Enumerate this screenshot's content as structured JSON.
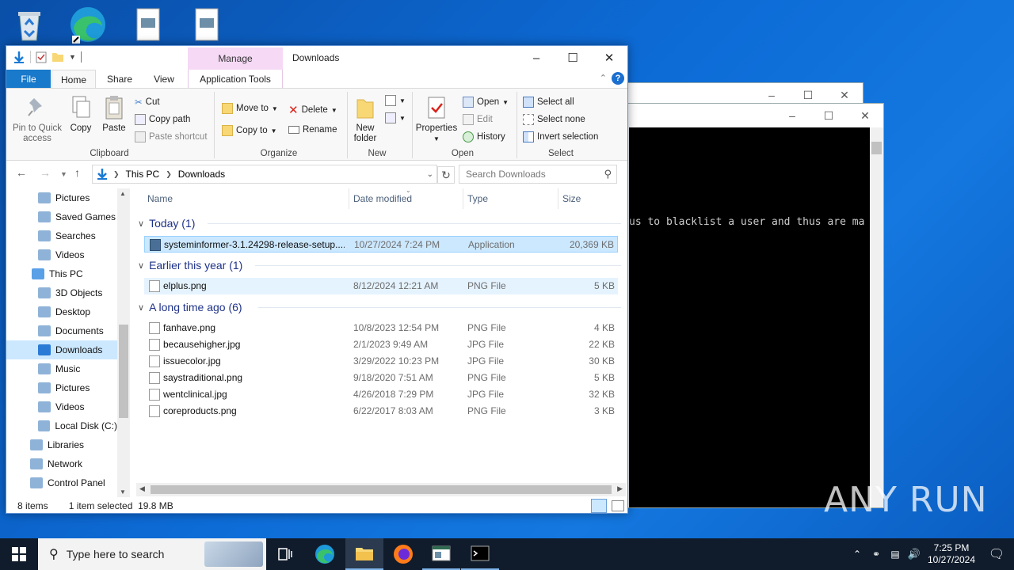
{
  "desktop": {
    "icons": [
      "recycle-bin",
      "edge",
      "image-file",
      "image-file"
    ]
  },
  "console_window": {
    "text": "us to blacklist a user and thus are ma"
  },
  "explorer": {
    "manage_tab": "Manage",
    "title": "Downloads",
    "tabs": {
      "file": "File",
      "home": "Home",
      "share": "Share",
      "view": "View",
      "app_tools": "Application Tools"
    },
    "ribbon": {
      "clipboard": {
        "pin": "Pin to Quick access",
        "copy": "Copy",
        "paste": "Paste",
        "cut": "Cut",
        "copy_path": "Copy path",
        "paste_shortcut": "Paste shortcut",
        "label": "Clipboard"
      },
      "organize": {
        "move_to": "Move to",
        "copy_to": "Copy to",
        "delete": "Delete",
        "rename": "Rename",
        "label": "Organize"
      },
      "new": {
        "new_folder": "New folder",
        "label": "New"
      },
      "open": {
        "properties": "Properties",
        "open": "Open",
        "edit": "Edit",
        "history": "History",
        "label": "Open"
      },
      "select": {
        "select_all": "Select all",
        "select_none": "Select none",
        "invert": "Invert selection",
        "label": "Select"
      }
    },
    "address": {
      "segments": [
        "This PC",
        "Downloads"
      ]
    },
    "search_placeholder": "Search Downloads",
    "nav": [
      {
        "label": "Pictures",
        "icon": "pictures-icon"
      },
      {
        "label": "Saved Games",
        "icon": "saved-games-icon"
      },
      {
        "label": "Searches",
        "icon": "searches-icon"
      },
      {
        "label": "Videos",
        "icon": "videos-icon"
      },
      {
        "label": "This PC",
        "icon": "this-pc-icon"
      },
      {
        "label": "3D Objects",
        "icon": "3d-objects-icon"
      },
      {
        "label": "Desktop",
        "icon": "desktop-icon"
      },
      {
        "label": "Documents",
        "icon": "documents-icon"
      },
      {
        "label": "Downloads",
        "icon": "downloads-icon"
      },
      {
        "label": "Music",
        "icon": "music-icon"
      },
      {
        "label": "Pictures",
        "icon": "pictures-icon"
      },
      {
        "label": "Videos",
        "icon": "videos-icon"
      },
      {
        "label": "Local Disk (C:)",
        "icon": "disk-icon"
      },
      {
        "label": "Libraries",
        "icon": "libraries-icon"
      },
      {
        "label": "Network",
        "icon": "network-icon"
      },
      {
        "label": "Control Panel",
        "icon": "control-panel-icon"
      }
    ],
    "columns": {
      "name": "Name",
      "date": "Date modified",
      "type": "Type",
      "size": "Size"
    },
    "groups": [
      {
        "title": "Today (1)",
        "files": [
          {
            "name": "systeminformer-3.1.24298-release-setup....",
            "date": "10/27/2024 7:24 PM",
            "type": "Application",
            "size": "20,369 KB"
          }
        ]
      },
      {
        "title": "Earlier this year (1)",
        "files": [
          {
            "name": "elplus.png",
            "date": "8/12/2024 12:21 AM",
            "type": "PNG File",
            "size": "5 KB"
          }
        ]
      },
      {
        "title": "A long time ago (6)",
        "files": [
          {
            "name": "fanhave.png",
            "date": "10/8/2023 12:54 PM",
            "type": "PNG File",
            "size": "4 KB"
          },
          {
            "name": "becausehigher.jpg",
            "date": "2/1/2023 9:49 AM",
            "type": "JPG File",
            "size": "22 KB"
          },
          {
            "name": "issuecolor.jpg",
            "date": "3/29/2022 10:23 PM",
            "type": "JPG File",
            "size": "30 KB"
          },
          {
            "name": "saystraditional.png",
            "date": "9/18/2020 7:51 AM",
            "type": "PNG File",
            "size": "5 KB"
          },
          {
            "name": "wentclinical.jpg",
            "date": "4/26/2018 7:29 PM",
            "type": "JPG File",
            "size": "32 KB"
          },
          {
            "name": "coreproducts.png",
            "date": "6/22/2017 8:03 AM",
            "type": "PNG File",
            "size": "3 KB"
          }
        ]
      }
    ],
    "status": {
      "items": "8 items",
      "selected": "1 item selected  19.8 MB"
    }
  },
  "taskbar": {
    "search_placeholder": "Type here to search",
    "time": "7:25 PM",
    "date": "10/27/2024"
  },
  "watermark": "ANY RUN"
}
